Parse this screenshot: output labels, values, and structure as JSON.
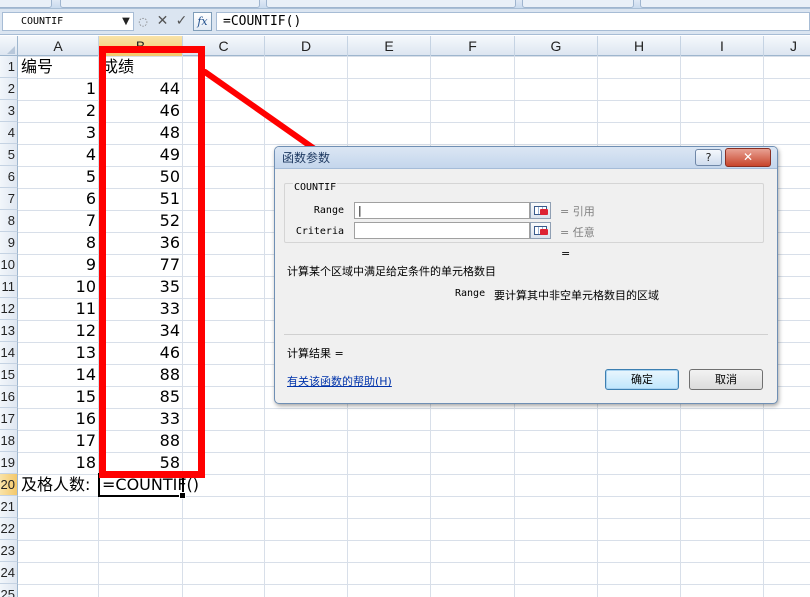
{
  "formula_bar": {
    "name_box": "COUNTIF",
    "dropdown_glyph": "▼",
    "separator_glyph": "◌",
    "cancel_glyph": "✕",
    "enter_glyph": "✓",
    "fx_label": "fx",
    "formula": "=COUNTIF()"
  },
  "grid": {
    "columns": [
      "A",
      "B",
      "C",
      "D",
      "E",
      "F",
      "G",
      "H",
      "I",
      "J"
    ],
    "active_column": "B",
    "rows": [
      "1",
      "2",
      "3",
      "4",
      "5",
      "6",
      "7",
      "8",
      "9",
      "10",
      "11",
      "12",
      "13",
      "14",
      "15",
      "16",
      "17",
      "18",
      "19",
      "20",
      "21",
      "22",
      "23",
      "24",
      "25"
    ],
    "active_row": "20",
    "header": {
      "a": "编号",
      "b": "成绩"
    },
    "data": [
      {
        "a": "1",
        "b": "44"
      },
      {
        "a": "2",
        "b": "46"
      },
      {
        "a": "3",
        "b": "48"
      },
      {
        "a": "4",
        "b": "49"
      },
      {
        "a": "5",
        "b": "50"
      },
      {
        "a": "6",
        "b": "51"
      },
      {
        "a": "7",
        "b": "52"
      },
      {
        "a": "8",
        "b": "36"
      },
      {
        "a": "9",
        "b": "77"
      },
      {
        "a": "10",
        "b": "35"
      },
      {
        "a": "11",
        "b": "33"
      },
      {
        "a": "12",
        "b": "34"
      },
      {
        "a": "13",
        "b": "46"
      },
      {
        "a": "14",
        "b": "88"
      },
      {
        "a": "15",
        "b": "85"
      },
      {
        "a": "16",
        "b": "33"
      },
      {
        "a": "17",
        "b": "88"
      },
      {
        "a": "18",
        "b": "58"
      }
    ],
    "footer": {
      "a": "及格人数:",
      "b": "=COUNTIF()"
    }
  },
  "annotation": {
    "color": "#ff0000"
  },
  "dialog": {
    "title": "函数参数",
    "help_button": "?",
    "close_button": "✕",
    "function_name": "COUNTIF",
    "args": [
      {
        "label": "Range",
        "value": "|",
        "hint": "=  引用"
      },
      {
        "label": "Criteria",
        "value": "",
        "hint": "=  任意"
      }
    ],
    "result_eq": "=",
    "description": "计算某个区域中满足给定条件的单元格数目",
    "arg_desc_name": "Range",
    "arg_desc_text": "要计算其中非空单元格数目的区域",
    "result_label": "计算结果 =",
    "help_link": "有关该函数的帮助(H)",
    "ok": "确定",
    "cancel": "取消"
  }
}
